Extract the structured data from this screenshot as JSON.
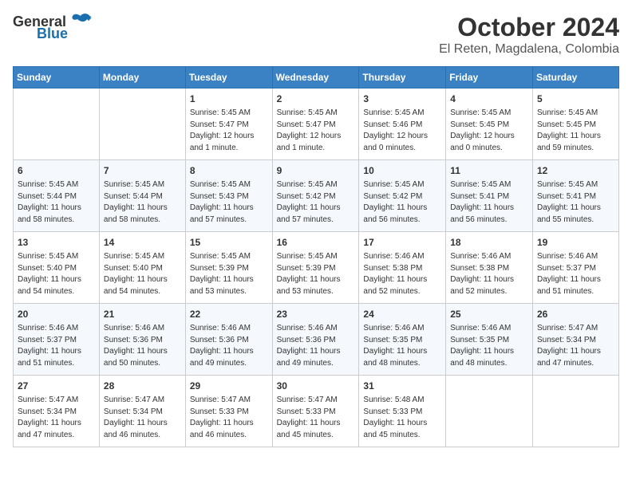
{
  "logo": {
    "general": "General",
    "blue": "Blue"
  },
  "title": "October 2024",
  "location": "El Reten, Magdalena, Colombia",
  "days_header": [
    "Sunday",
    "Monday",
    "Tuesday",
    "Wednesday",
    "Thursday",
    "Friday",
    "Saturday"
  ],
  "weeks": [
    [
      {
        "day": "",
        "content": ""
      },
      {
        "day": "",
        "content": ""
      },
      {
        "day": "1",
        "content": "Sunrise: 5:45 AM\nSunset: 5:47 PM\nDaylight: 12 hours\nand 1 minute."
      },
      {
        "day": "2",
        "content": "Sunrise: 5:45 AM\nSunset: 5:47 PM\nDaylight: 12 hours\nand 1 minute."
      },
      {
        "day": "3",
        "content": "Sunrise: 5:45 AM\nSunset: 5:46 PM\nDaylight: 12 hours\nand 0 minutes."
      },
      {
        "day": "4",
        "content": "Sunrise: 5:45 AM\nSunset: 5:45 PM\nDaylight: 12 hours\nand 0 minutes."
      },
      {
        "day": "5",
        "content": "Sunrise: 5:45 AM\nSunset: 5:45 PM\nDaylight: 11 hours\nand 59 minutes."
      }
    ],
    [
      {
        "day": "6",
        "content": "Sunrise: 5:45 AM\nSunset: 5:44 PM\nDaylight: 11 hours\nand 58 minutes."
      },
      {
        "day": "7",
        "content": "Sunrise: 5:45 AM\nSunset: 5:44 PM\nDaylight: 11 hours\nand 58 minutes."
      },
      {
        "day": "8",
        "content": "Sunrise: 5:45 AM\nSunset: 5:43 PM\nDaylight: 11 hours\nand 57 minutes."
      },
      {
        "day": "9",
        "content": "Sunrise: 5:45 AM\nSunset: 5:42 PM\nDaylight: 11 hours\nand 57 minutes."
      },
      {
        "day": "10",
        "content": "Sunrise: 5:45 AM\nSunset: 5:42 PM\nDaylight: 11 hours\nand 56 minutes."
      },
      {
        "day": "11",
        "content": "Sunrise: 5:45 AM\nSunset: 5:41 PM\nDaylight: 11 hours\nand 56 minutes."
      },
      {
        "day": "12",
        "content": "Sunrise: 5:45 AM\nSunset: 5:41 PM\nDaylight: 11 hours\nand 55 minutes."
      }
    ],
    [
      {
        "day": "13",
        "content": "Sunrise: 5:45 AM\nSunset: 5:40 PM\nDaylight: 11 hours\nand 54 minutes."
      },
      {
        "day": "14",
        "content": "Sunrise: 5:45 AM\nSunset: 5:40 PM\nDaylight: 11 hours\nand 54 minutes."
      },
      {
        "day": "15",
        "content": "Sunrise: 5:45 AM\nSunset: 5:39 PM\nDaylight: 11 hours\nand 53 minutes."
      },
      {
        "day": "16",
        "content": "Sunrise: 5:45 AM\nSunset: 5:39 PM\nDaylight: 11 hours\nand 53 minutes."
      },
      {
        "day": "17",
        "content": "Sunrise: 5:46 AM\nSunset: 5:38 PM\nDaylight: 11 hours\nand 52 minutes."
      },
      {
        "day": "18",
        "content": "Sunrise: 5:46 AM\nSunset: 5:38 PM\nDaylight: 11 hours\nand 52 minutes."
      },
      {
        "day": "19",
        "content": "Sunrise: 5:46 AM\nSunset: 5:37 PM\nDaylight: 11 hours\nand 51 minutes."
      }
    ],
    [
      {
        "day": "20",
        "content": "Sunrise: 5:46 AM\nSunset: 5:37 PM\nDaylight: 11 hours\nand 51 minutes."
      },
      {
        "day": "21",
        "content": "Sunrise: 5:46 AM\nSunset: 5:36 PM\nDaylight: 11 hours\nand 50 minutes."
      },
      {
        "day": "22",
        "content": "Sunrise: 5:46 AM\nSunset: 5:36 PM\nDaylight: 11 hours\nand 49 minutes."
      },
      {
        "day": "23",
        "content": "Sunrise: 5:46 AM\nSunset: 5:36 PM\nDaylight: 11 hours\nand 49 minutes."
      },
      {
        "day": "24",
        "content": "Sunrise: 5:46 AM\nSunset: 5:35 PM\nDaylight: 11 hours\nand 48 minutes."
      },
      {
        "day": "25",
        "content": "Sunrise: 5:46 AM\nSunset: 5:35 PM\nDaylight: 11 hours\nand 48 minutes."
      },
      {
        "day": "26",
        "content": "Sunrise: 5:47 AM\nSunset: 5:34 PM\nDaylight: 11 hours\nand 47 minutes."
      }
    ],
    [
      {
        "day": "27",
        "content": "Sunrise: 5:47 AM\nSunset: 5:34 PM\nDaylight: 11 hours\nand 47 minutes."
      },
      {
        "day": "28",
        "content": "Sunrise: 5:47 AM\nSunset: 5:34 PM\nDaylight: 11 hours\nand 46 minutes."
      },
      {
        "day": "29",
        "content": "Sunrise: 5:47 AM\nSunset: 5:33 PM\nDaylight: 11 hours\nand 46 minutes."
      },
      {
        "day": "30",
        "content": "Sunrise: 5:47 AM\nSunset: 5:33 PM\nDaylight: 11 hours\nand 45 minutes."
      },
      {
        "day": "31",
        "content": "Sunrise: 5:48 AM\nSunset: 5:33 PM\nDaylight: 11 hours\nand 45 minutes."
      },
      {
        "day": "",
        "content": ""
      },
      {
        "day": "",
        "content": ""
      }
    ]
  ]
}
